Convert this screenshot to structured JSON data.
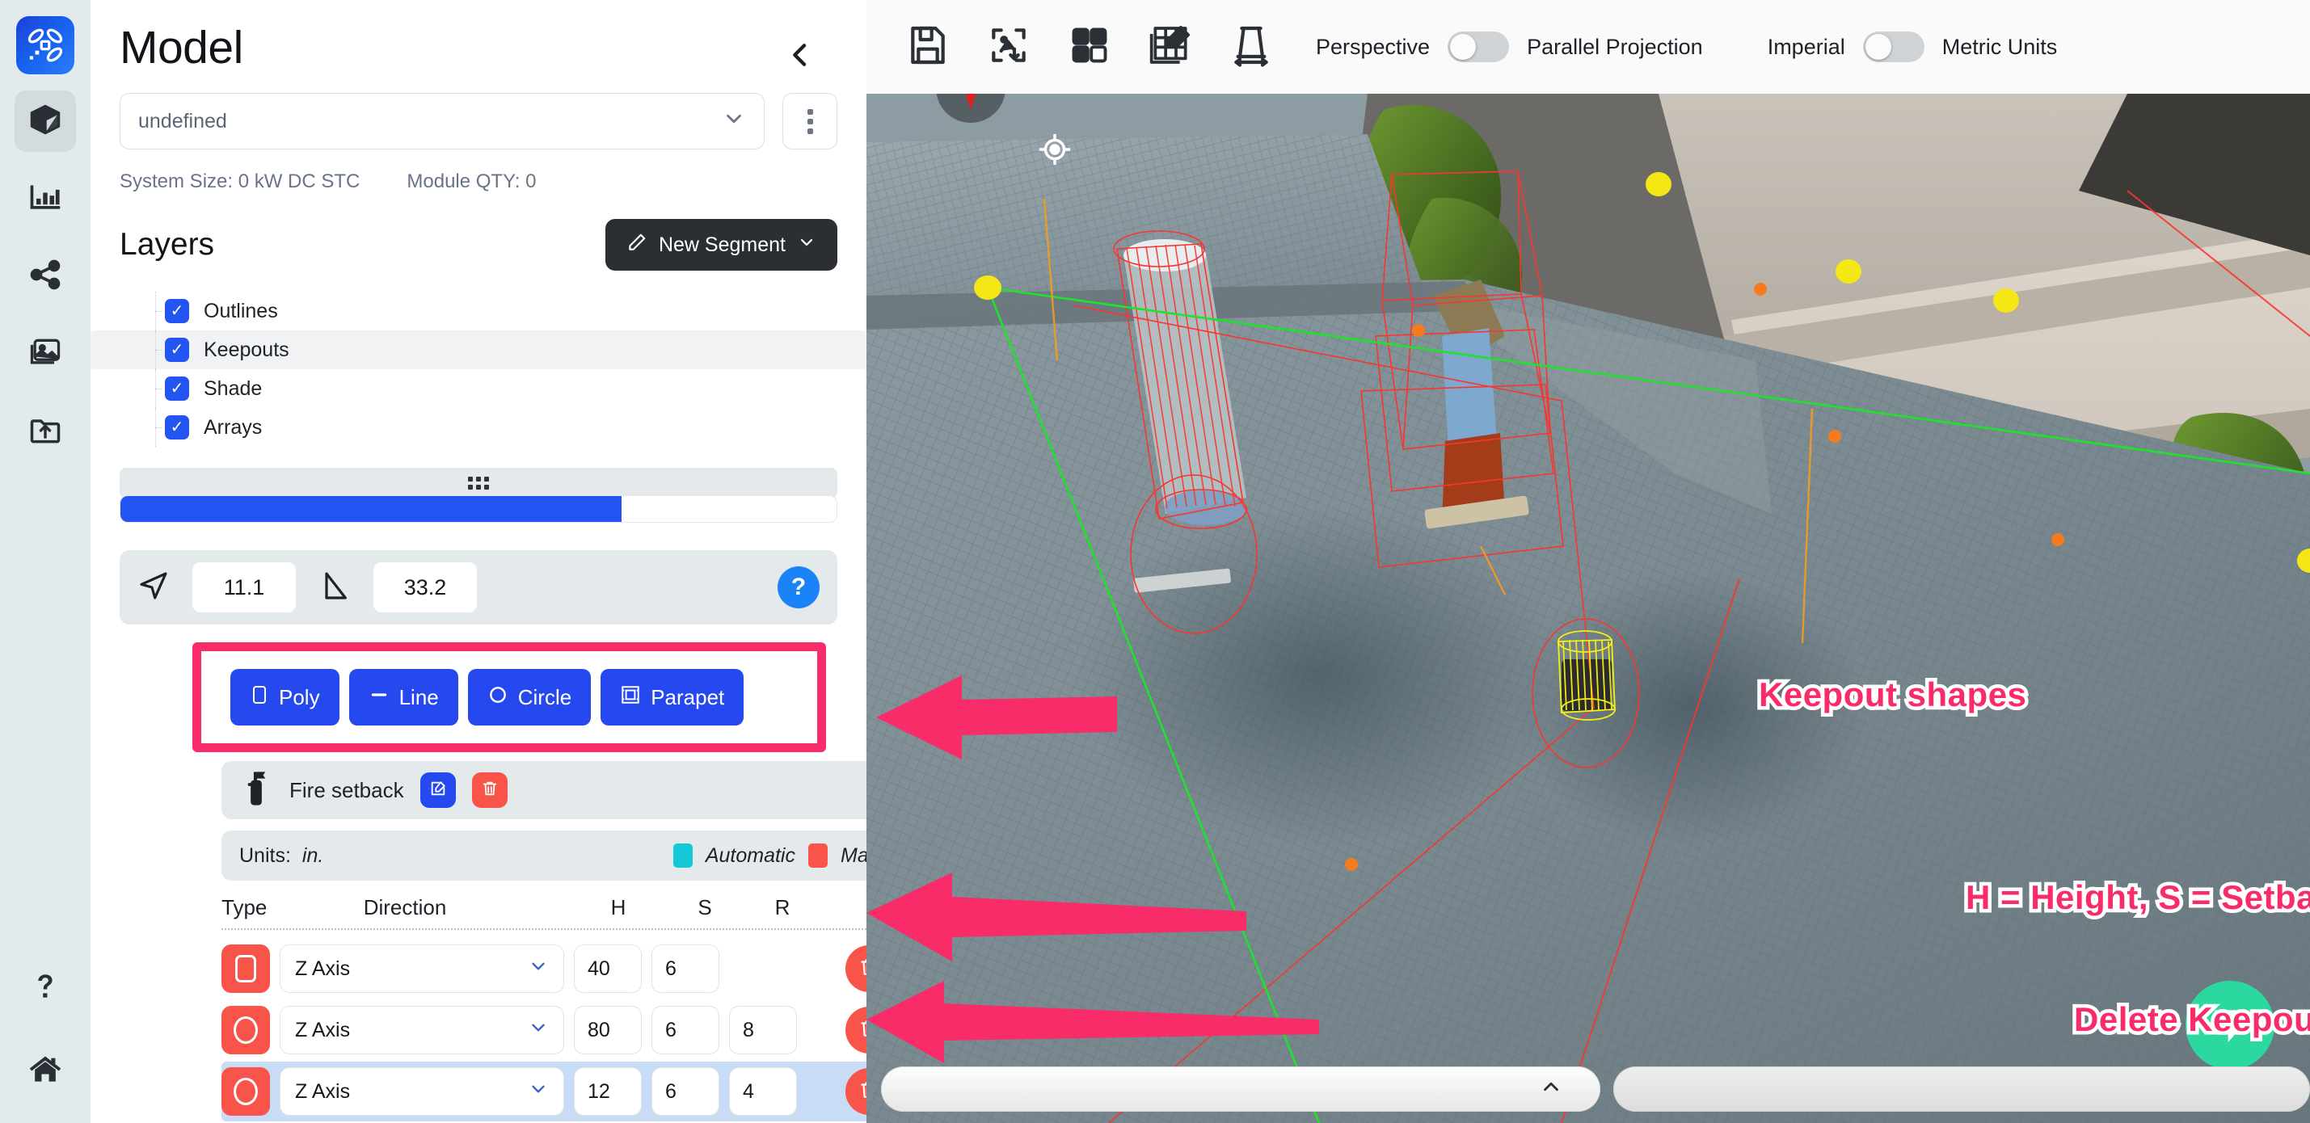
{
  "rail": {
    "brand_icon": "drone-logo-icon",
    "items": [
      {
        "icon": "cube-3d-icon",
        "name": "model",
        "active": true
      },
      {
        "icon": "bar-chart-icon",
        "name": "analysis",
        "active": false
      },
      {
        "icon": "share-nodes-icon",
        "name": "share",
        "active": false
      },
      {
        "icon": "images-gallery-icon",
        "name": "gallery",
        "active": false
      },
      {
        "icon": "folder-upload-icon",
        "name": "upload",
        "active": false
      }
    ],
    "bottom_items": [
      {
        "icon": "question-mark-icon",
        "name": "help"
      },
      {
        "icon": "home-icon",
        "name": "home"
      }
    ]
  },
  "panel": {
    "title": "Model",
    "collapse_icon": "chevron-left-icon",
    "design_select": {
      "value": "undefined",
      "chevron": "chevron-down-icon"
    },
    "kebab_icon": "vertical-dots-icon",
    "stats": {
      "system_size": "System Size: 0 kW DC STC",
      "module_qty": "Module QTY: 0"
    },
    "layers_title": "Layers",
    "new_segment": {
      "label": "New Segment",
      "icon": "pencil-icon",
      "chevron": "chevron-down-icon"
    },
    "layers": [
      {
        "label": "Outlines",
        "checked": true,
        "highlighted": false
      },
      {
        "label": "Keepouts",
        "checked": true,
        "highlighted": true
      },
      {
        "label": "Shade",
        "checked": true,
        "highlighted": false
      },
      {
        "label": "Arrays",
        "checked": true,
        "highlighted": false
      }
    ],
    "drag_handle_icon": "grip-dots-icon",
    "progress_percent": 70,
    "measurements": {
      "azimuth": {
        "icon": "navigation-arrow-icon",
        "value": "11.1"
      },
      "pitch": {
        "icon": "right-triangle-icon",
        "value": "33.2"
      },
      "help_icon": "question-circle-icon"
    },
    "shape_tools": [
      {
        "label": "Poly",
        "icon": "rounded-square-icon"
      },
      {
        "label": "Line",
        "icon": "minus-line-icon"
      },
      {
        "label": "Circle",
        "icon": "circle-outline-icon"
      },
      {
        "label": "Parapet",
        "icon": "parapet-frame-icon"
      }
    ],
    "fire_setback": {
      "label": "Fire setback",
      "icon": "fire-extinguisher-icon",
      "edit_icon": "edit-square-icon",
      "delete_icon": "trash-icon"
    },
    "units_bar": {
      "label": "Units:",
      "unit": "in.",
      "legend": [
        {
          "label": "Automatic",
          "color": "#14c8d8"
        },
        {
          "label": "Manual",
          "color": "#f8544a"
        }
      ]
    },
    "table": {
      "columns": [
        "Type",
        "Direction",
        "H",
        "S",
        "R"
      ],
      "rows": [
        {
          "type_icon": "rounded-square-icon",
          "type_color": "#f8544a",
          "direction": "Z Axis",
          "h": "40",
          "s": "6",
          "r": "",
          "focused": false,
          "delete_icon": "trash-icon"
        },
        {
          "type_icon": "circle-outline-icon",
          "type_color": "#f8544a",
          "direction": "Z Axis",
          "h": "80",
          "s": "6",
          "r": "8",
          "focused": false,
          "delete_icon": "trash-icon"
        },
        {
          "type_icon": "circle-outline-icon",
          "type_color": "#f8544a",
          "direction": "Z Axis",
          "h": "12",
          "s": "6",
          "r": "4",
          "focused": true,
          "delete_icon": "trash-icon"
        }
      ]
    }
  },
  "viewport": {
    "tools": [
      {
        "icon": "save-floppy-icon",
        "name": "save"
      },
      {
        "icon": "image-download-icon",
        "name": "export-image"
      },
      {
        "icon": "grid-panels-icon",
        "name": "layout-grid"
      },
      {
        "icon": "table-edit-icon",
        "name": "edit-table"
      },
      {
        "icon": "measure-tape-icon",
        "name": "measure"
      }
    ],
    "toggles": [
      {
        "left_label": "Perspective",
        "right_label": "Parallel Projection",
        "on": false
      },
      {
        "left_label": "Imperial",
        "right_label": "Metric Units",
        "on": false
      }
    ],
    "compass_icon": "compass-needle-icon",
    "target_icon": "crosshair-target-icon",
    "menu_icon": "hamburger-menu-icon",
    "chat_icon": "chat-bubble-icon",
    "bottom_bar_chevron": "chevron-up-icon"
  },
  "annotations": {
    "color": "#f82c68",
    "items": [
      {
        "text": "Keepout shapes"
      },
      {
        "text": "H = Height, S = Setback, R = Radius"
      },
      {
        "text": "Delete Keepout"
      }
    ]
  }
}
